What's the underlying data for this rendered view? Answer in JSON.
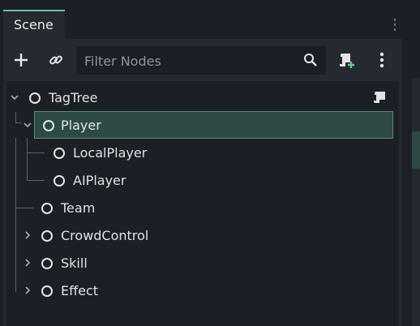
{
  "dock": {
    "tab_label": "Scene"
  },
  "toolbar": {
    "filter_placeholder": "Filter Nodes",
    "add_icon": "plus-icon",
    "link_icon": "link-icon",
    "search_icon": "search-icon",
    "script_add_icon": "script-add-icon",
    "menu_icon": "kebab-menu-icon"
  },
  "tree": {
    "nodes": [
      {
        "label": "TagTree",
        "expanded": true,
        "has_script": true
      },
      {
        "label": "Player",
        "expanded": true,
        "selected": true
      },
      {
        "label": "LocalPlayer"
      },
      {
        "label": "AIPlayer"
      },
      {
        "label": "Team"
      },
      {
        "label": "CrowdControl",
        "expanded": false
      },
      {
        "label": "Skill",
        "expanded": false
      },
      {
        "label": "Effect",
        "expanded": false
      }
    ]
  },
  "colors": {
    "accent": "#70bbae",
    "selection_bg": "#2e4a45",
    "panel_bg": "#252930",
    "tree_bg": "#1c1f25"
  }
}
